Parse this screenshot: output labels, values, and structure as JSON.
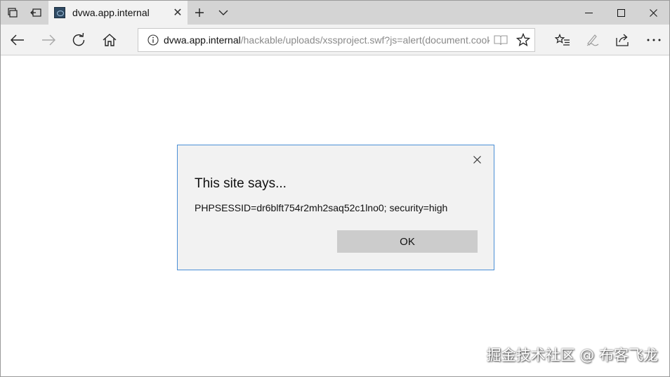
{
  "browser": {
    "tab": {
      "title": "dvwa.app.internal",
      "close_glyph": "✕"
    },
    "newtab_glyph": "+",
    "address": {
      "host": "dvwa.app.internal",
      "path": "/hackable/uploads/xssproject.swf?js=alert(document.cookie);"
    }
  },
  "dialog": {
    "title": "This site says...",
    "message": "PHPSESSID=dr6blft754r2mh2saq52c1lno0; security=high",
    "ok_label": "OK",
    "close_glyph": "✕"
  },
  "watermark": "掘金技术社区 @ 布客飞龙",
  "colors": {
    "tabbar_bg": "#d4d4d4",
    "toolbar_bg": "#f2f2f2",
    "dialog_border": "#4a8fd6",
    "ok_button_bg": "#cccccc"
  }
}
